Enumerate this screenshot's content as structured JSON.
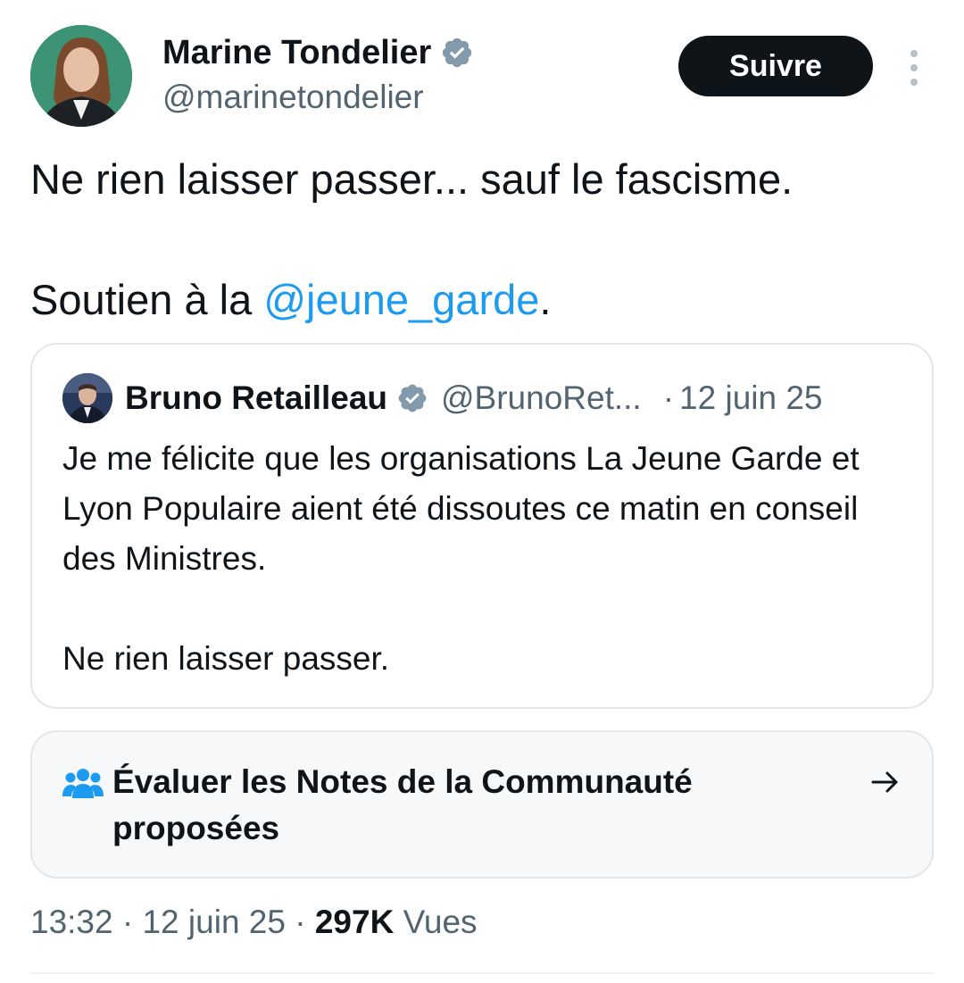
{
  "author": {
    "display_name": "Marine Tondelier",
    "handle": "@marinetondelier",
    "verified_icon": "verified-badge-icon"
  },
  "follow_button": {
    "label": "Suivre"
  },
  "tweet": {
    "line1": "Ne rien laisser passer... sauf le fascisme.",
    "line2_prefix": "Soutien à la ",
    "line2_mention": "@jeune_garde",
    "line2_suffix": "."
  },
  "quoted": {
    "display_name": "Bruno Retailleau",
    "handle": "@BrunoRet...",
    "separator": "·",
    "date": "12 juin 25",
    "paragraph1": "Je me félicite que les organisations La Jeune Garde et Lyon Populaire aient été dissoutes ce matin en conseil des Ministres.",
    "paragraph2": "Ne rien laisser passer."
  },
  "community_notes": {
    "label": "Évaluer les Notes de la Communauté proposées",
    "icon": "people-icon",
    "arrow_icon": "arrow-right-icon"
  },
  "meta": {
    "time": "13:32",
    "sep1": " · ",
    "date": "12 juin 25",
    "sep2": " · ",
    "views_count": "297K",
    "views_label": " Vues"
  },
  "colors": {
    "link": "#1d9bf0",
    "secondary_text": "#536471",
    "primary_text": "#0f1419",
    "button_bg": "#0f1419"
  }
}
